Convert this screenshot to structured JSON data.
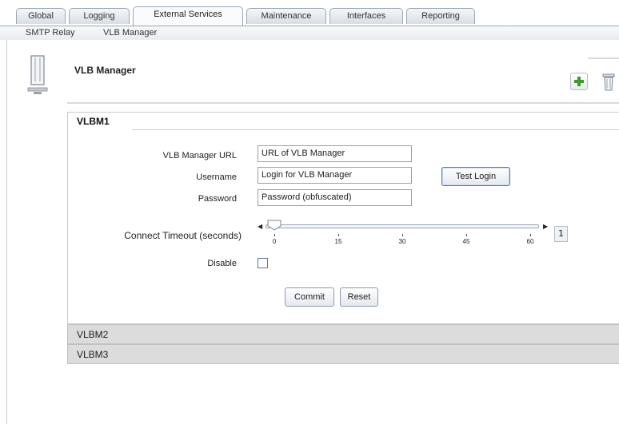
{
  "tabs": [
    {
      "label": "Global",
      "active": false
    },
    {
      "label": "Logging",
      "active": false
    },
    {
      "label": "External Services",
      "active": true
    },
    {
      "label": "Maintenance",
      "active": false
    },
    {
      "label": "Interfaces",
      "active": false
    },
    {
      "label": "Reporting",
      "active": false
    }
  ],
  "subnav": {
    "items": [
      "SMTP Relay",
      "VLB Manager"
    ],
    "selected": "VLB Manager"
  },
  "header": {
    "title": "VLB Manager",
    "icon": "server-icon",
    "add_icon": "plus-icon",
    "trash_icon": "trash-icon"
  },
  "panel": {
    "title": "VLBM1",
    "url_label": "VLB Manager URL",
    "url_value": "URL of VLB Manager",
    "username_label": "Username",
    "username_value": "Login for VLB Manager",
    "password_label": "Password",
    "password_value": "Password (obfuscated)",
    "test_login": "Test Login",
    "timeout_label": "Connect Timeout (seconds)",
    "timeout_ticks": [
      "0",
      "15",
      "30",
      "45",
      "60"
    ],
    "timeout_value": "1",
    "disable_label": "Disable",
    "disable_checked": false,
    "commit": "Commit",
    "reset": "Reset"
  },
  "collapsed_panels": [
    "VLBM2",
    "VLBM3"
  ],
  "colors": {
    "accent": "#5a78a8",
    "add_green": "#3d9a2b",
    "collapsed_bg": "#dcdcdc"
  }
}
